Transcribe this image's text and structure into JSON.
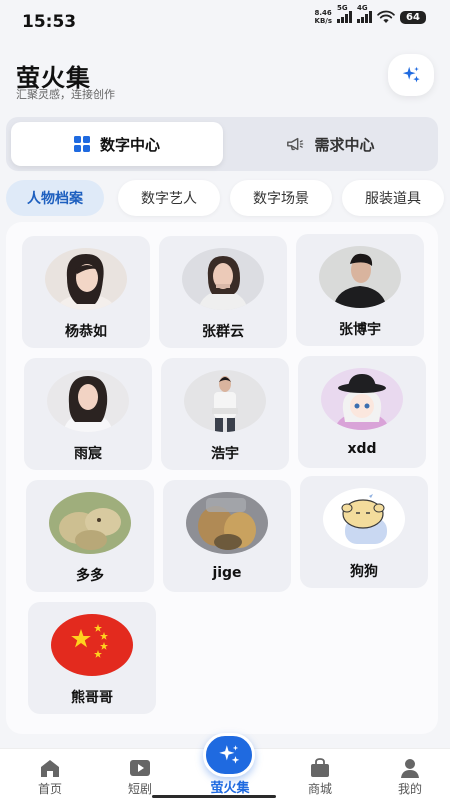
{
  "status_bar": {
    "time": "15:53",
    "net_speed_value": "8.46",
    "net_speed_unit": "KB/s",
    "signal_1_label": "5G",
    "signal_2_label": "4G",
    "battery": "64"
  },
  "header": {
    "title": "萤火集",
    "subtitle": "汇聚灵感，连接创作",
    "action_icon": "sparkle-icon"
  },
  "segment_tabs": [
    {
      "label": "数字中心",
      "icon": "grid-icon",
      "active": true
    },
    {
      "label": "需求中心",
      "icon": "megaphone-icon",
      "active": false
    }
  ],
  "chips": [
    {
      "label": "人物档案",
      "active": true
    },
    {
      "label": "数字艺人",
      "active": false
    },
    {
      "label": "数字场景",
      "active": false
    },
    {
      "label": "服装道具",
      "active": false
    }
  ],
  "profiles": [
    {
      "name": "杨恭如"
    },
    {
      "name": "张群云"
    },
    {
      "name": "张博宇"
    },
    {
      "name": "雨宸"
    },
    {
      "name": "浩宇"
    },
    {
      "name": "xdd"
    },
    {
      "name": "多多"
    },
    {
      "name": "jige"
    },
    {
      "name": "狗狗"
    },
    {
      "name": "熊哥哥"
    }
  ],
  "bottom_nav": [
    {
      "label": "首页",
      "icon": "home-icon"
    },
    {
      "label": "短剧",
      "icon": "play-icon"
    },
    {
      "label": "萤火集",
      "icon": "sparkle-icon",
      "active": true
    },
    {
      "label": "商城",
      "icon": "shopping-bag-icon"
    },
    {
      "label": "我的",
      "icon": "person-icon"
    }
  ],
  "colors": {
    "accent": "#1f6ae0",
    "chip_active_bg": "#dfeaf8",
    "card_bg": "#eeeff4"
  }
}
